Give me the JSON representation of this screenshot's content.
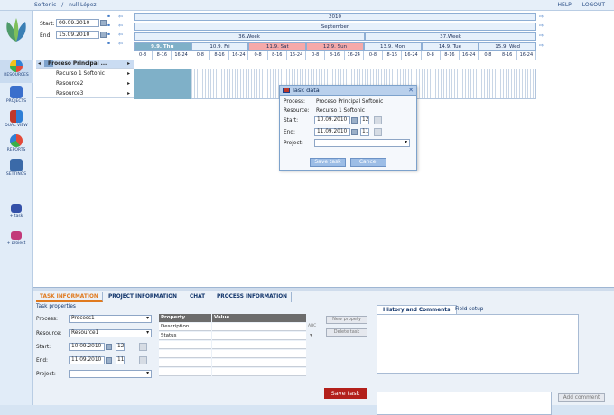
{
  "topbar": {
    "breadcrumb": [
      "Softonic",
      "/",
      "null López"
    ],
    "help": "HELP",
    "logout": "LOGOUT"
  },
  "nav": [
    {
      "label": "RESOURCES",
      "icon": "resources-icon"
    },
    {
      "label": "PROJECTS",
      "icon": "projects-icon"
    },
    {
      "label": "DUAL VIEW",
      "icon": "dual-view-icon"
    },
    {
      "label": "REPORTS",
      "icon": "reports-icon"
    },
    {
      "label": "SETTINGS",
      "icon": "settings-icon"
    },
    {
      "label": "+ task",
      "icon": "add-task-icon"
    },
    {
      "label": "+ project",
      "icon": "add-project-icon"
    }
  ],
  "dates": {
    "start_label": "Start:",
    "start": "09.09.2010",
    "end_label": "End:",
    "end": "15.09.2010"
  },
  "header": {
    "year": "2010",
    "month": "September",
    "weeks": [
      "36.Week",
      "37.Week"
    ],
    "days": [
      "9.9. Thu",
      "10.9. Fri",
      "11.9. Sat",
      "12.9. Sun",
      "13.9. Mon",
      "14.9. Tue",
      "15.9. Wed"
    ],
    "slots": [
      "0-8",
      "8-16",
      "16-24"
    ]
  },
  "tree": {
    "process": "Proceso Principal ...",
    "resources": [
      "Recurso 1 Softonic",
      "Resource2",
      "Resource3"
    ]
  },
  "dialog": {
    "title": "Task data",
    "process_label": "Process:",
    "process": "Proceso Principal Softonic",
    "resource_label": "Resource:",
    "resource": "Recurso 1 Softonic",
    "start_label": "Start:",
    "start": "10.09.2010",
    "start_hour": "12",
    "end_label": "End:",
    "end": "11.09.2010",
    "end_hour": "11",
    "project_label": "Project:",
    "save": "Save task",
    "cancel": "Cancel"
  },
  "bottom": {
    "tabs": [
      "TASK INFORMATION",
      "PROJECT INFORMATION",
      "CHAT",
      "PROCESS INFORMATION"
    ],
    "section": "Task properties",
    "process_label": "Process:",
    "process": "Process1",
    "resource_label": "Resource:",
    "resource": "Resource1",
    "start_label": "Start:",
    "start": "10.09.2010",
    "start_hour": "12",
    "end_label": "End:",
    "end": "11.09.2010",
    "end_hour": "11",
    "project_label": "Project:",
    "table_headers": [
      "Property",
      "Value"
    ],
    "table_rows": [
      "Description",
      "Status"
    ],
    "abc": "ABC",
    "new_property": "New propety",
    "delete_task": "Delete task",
    "save_task": "Save task",
    "history_tabs": [
      "History and Comments",
      "Field setup"
    ],
    "add_comment": "Add comment"
  }
}
